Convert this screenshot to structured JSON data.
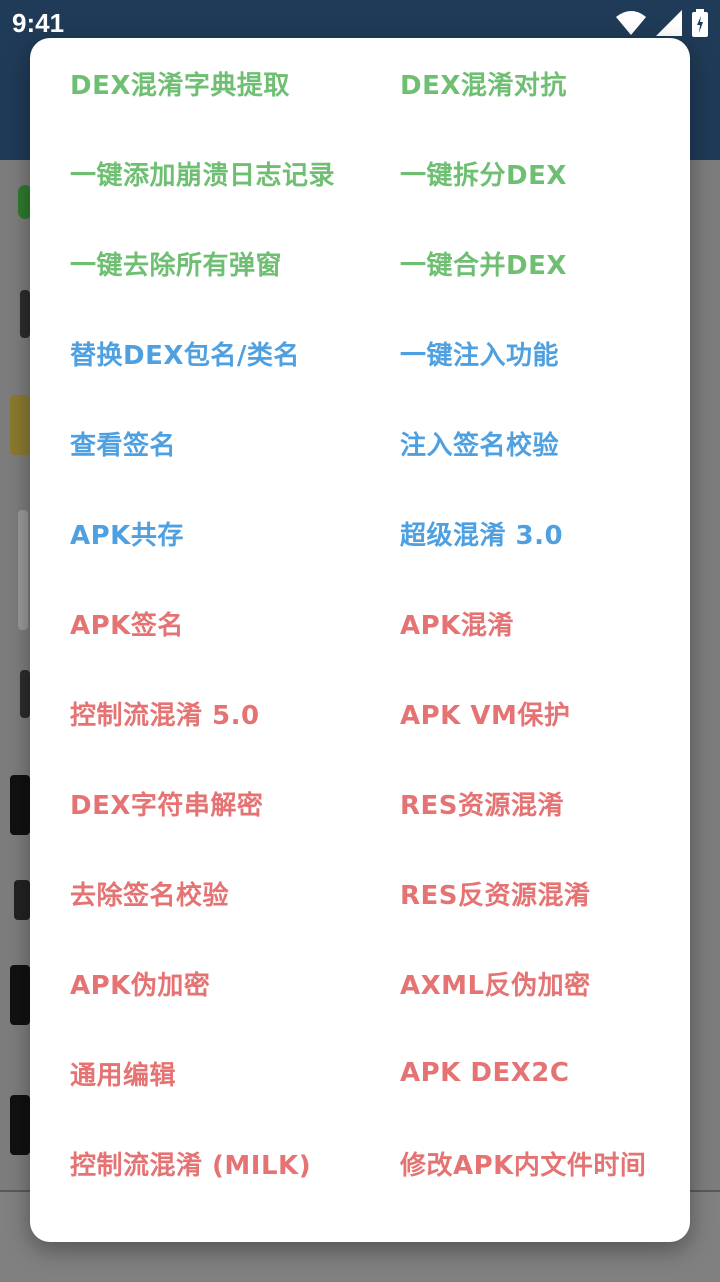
{
  "status_bar": {
    "time": "9:41"
  },
  "colors": {
    "green": "#6fbf73",
    "blue": "#4fa0e0",
    "red": "#e57373"
  },
  "menu": [
    {
      "label": "DEX混淆字典提取",
      "color": "green"
    },
    {
      "label": "DEX混淆对抗",
      "color": "green"
    },
    {
      "label": "一键添加崩溃日志记录",
      "color": "green"
    },
    {
      "label": "一键拆分DEX",
      "color": "green"
    },
    {
      "label": "一键去除所有弹窗",
      "color": "green"
    },
    {
      "label": "一键合并DEX",
      "color": "green"
    },
    {
      "label": "替换DEX包名/类名",
      "color": "blue"
    },
    {
      "label": "一键注入功能",
      "color": "blue"
    },
    {
      "label": "查看签名",
      "color": "blue"
    },
    {
      "label": "注入签名校验",
      "color": "blue"
    },
    {
      "label": "APK共存",
      "color": "blue"
    },
    {
      "label": "超级混淆 3.0",
      "color": "blue"
    },
    {
      "label": "APK签名",
      "color": "red"
    },
    {
      "label": "APK混淆",
      "color": "red"
    },
    {
      "label": "控制流混淆 5.0",
      "color": "red"
    },
    {
      "label": "APK VM保护",
      "color": "red"
    },
    {
      "label": "DEX字符串解密",
      "color": "red"
    },
    {
      "label": "RES资源混淆",
      "color": "red"
    },
    {
      "label": "去除签名校验",
      "color": "red"
    },
    {
      "label": "RES反资源混淆",
      "color": "red"
    },
    {
      "label": "APK伪加密",
      "color": "red"
    },
    {
      "label": "AXML反伪加密",
      "color": "red"
    },
    {
      "label": "通用编辑",
      "color": "red"
    },
    {
      "label": "APK DEX2C",
      "color": "red"
    },
    {
      "label": "控制流混淆 (MILK)",
      "color": "red"
    },
    {
      "label": "修改APK内文件时间",
      "color": "red"
    }
  ]
}
